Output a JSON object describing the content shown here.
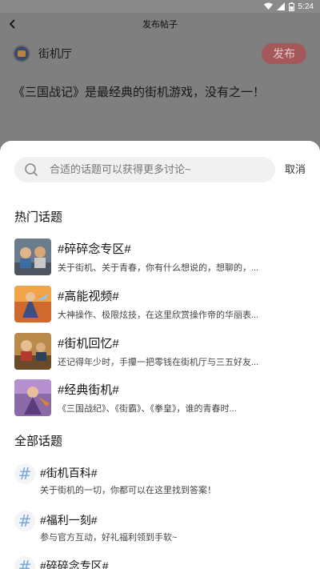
{
  "status_bar": {
    "time": "5:24"
  },
  "header": {
    "title": "发布帖子"
  },
  "post": {
    "author_name": "街机厅",
    "publish_label": "发布",
    "text": "《三国战记》是最经典的街机游戏，没有之一！"
  },
  "search": {
    "placeholder": "合适的话题可以获得更多讨论~",
    "cancel_label": "取消"
  },
  "hot_topics": {
    "title": "热门话题",
    "items": [
      {
        "title": "#碎碎念专区#",
        "desc": "关于街机、关于青春，你有什么想说的，想聊的，..."
      },
      {
        "title": "#高能视频#",
        "desc": "大神操作、极限炫技，在这里欣赏操作帝的华丽表..."
      },
      {
        "title": "#街机回忆#",
        "desc": "还记得年少时，手攥一把零钱在街机厅与三五好友..."
      },
      {
        "title": "#经典街机#",
        "desc": "《三国战纪》、《街霸》、《拳皇》，谁的青春时..."
      }
    ]
  },
  "all_topics": {
    "title": "全部话题",
    "items": [
      {
        "title": "#街机百科#",
        "desc": "关于街机的一切，你都可以在这里找到答案！"
      },
      {
        "title": "#福利一刻#",
        "desc": "参与官方互动，好礼福利领到手软~"
      },
      {
        "title": "#碎碎念专区#",
        "desc": ""
      }
    ]
  },
  "colors": {
    "overlay": "#7f7f7f",
    "publish_button": "#a5585a",
    "hash_icon": "#7aa9d6"
  }
}
